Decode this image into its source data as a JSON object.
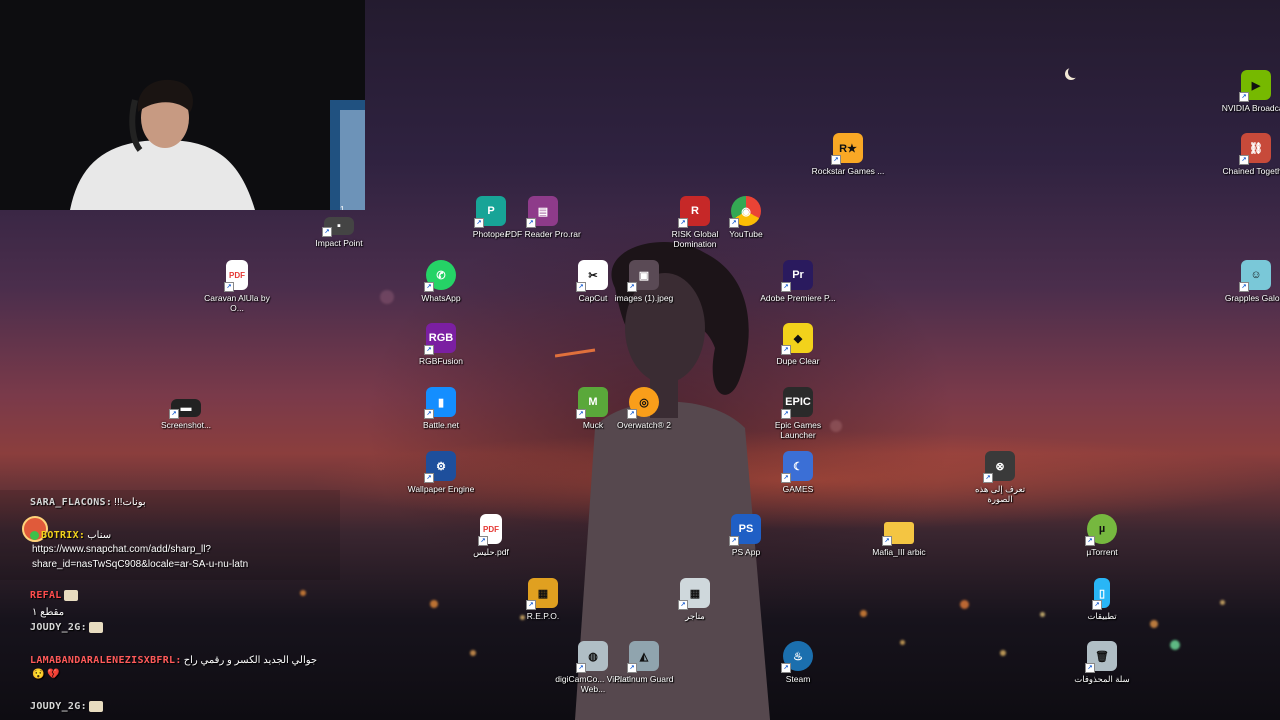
{
  "colors": {
    "sky_top": "#241b2f",
    "sunset": "#8b3e3d",
    "ground": "#0e0c12"
  },
  "webcam": {
    "corner_badge": "1"
  },
  "desktop": {
    "icons": [
      {
        "label": "NVIDIA Broadcast",
        "icon": "nvidia-broadcast-icon",
        "color": "#76b900"
      },
      {
        "label": "Chained Together",
        "icon": "chained-together-icon",
        "color": "#c74a3a"
      },
      {
        "label": "Grapples Galore",
        "icon": "grapples-galore-icon",
        "color": "#7ac8d8"
      },
      {
        "label": "Rockstar Games ...",
        "icon": "rockstar-games-icon",
        "color": "#f9a825"
      },
      {
        "label": "Photopea",
        "icon": "photopea-icon",
        "color": "#18a497"
      },
      {
        "label": "PDF Reader Pro.rar",
        "icon": "winrar-archive-icon",
        "color": "#8e3b8a"
      },
      {
        "label": "RISK Global Domination",
        "icon": "risk-icon",
        "color": "#c62828"
      },
      {
        "label": "YouTube",
        "icon": "chrome-icon",
        "color": "#4285f4"
      },
      {
        "label": "Impact Point",
        "icon": "impact-point-icon",
        "color": "#444"
      },
      {
        "label": "Caravan AlUla by O...",
        "icon": "pdf-file-icon",
        "color": "#e53935"
      },
      {
        "label": "WhatsApp",
        "icon": "whatsapp-icon",
        "color": "#25d366"
      },
      {
        "label": "CapCut",
        "icon": "capcut-icon",
        "color": "#ffffff"
      },
      {
        "label": "images (1).jpeg",
        "icon": "image-file-icon",
        "color": "#5a4a55"
      },
      {
        "label": "Adobe Premiere P...",
        "icon": "premiere-pro-icon",
        "color": "#2a1a5e"
      },
      {
        "label": "RGBFusion",
        "icon": "rgbfusion-icon",
        "color": "#7b1fa2"
      },
      {
        "label": "Dupe Clear",
        "icon": "dupe-clear-icon",
        "color": "#f2d21b"
      },
      {
        "label": "Screenshot...",
        "icon": "screenshot-file-icon",
        "color": "#222"
      },
      {
        "label": "Battle.net",
        "icon": "battlenet-icon",
        "color": "#148eff"
      },
      {
        "label": "Muck",
        "icon": "muck-icon",
        "color": "#5aa83a"
      },
      {
        "label": "Overwatch® 2",
        "icon": "overwatch-icon",
        "color": "#f99e1a"
      },
      {
        "label": "Epic Games Launcher",
        "icon": "epic-games-icon",
        "color": "#2a2a2a"
      },
      {
        "label": "Wallpaper Engine",
        "icon": "wallpaper-engine-icon",
        "color": "#1e4f9c"
      },
      {
        "label": "GAMES",
        "icon": "games-folder-icon",
        "color": "#3b6fd6"
      },
      {
        "label": "تعرف إلى هذه الصورة",
        "icon": "learn-about-picture-icon",
        "color": "#3a3a3a"
      },
      {
        "label": "حليس.pdf",
        "icon": "pdf-file-icon",
        "color": "#e53935"
      },
      {
        "label": "PS App",
        "icon": "playstation-icon",
        "color": "#1f5fc5"
      },
      {
        "label": "Mafia_III arbic",
        "icon": "folder-icon",
        "color": "#f4c542"
      },
      {
        "label": "µTorrent",
        "icon": "utorrent-icon",
        "color": "#76b83f"
      },
      {
        "label": "R.E.P.O.",
        "icon": "repo-game-icon",
        "color": "#e0a020"
      },
      {
        "label": "متاجر",
        "icon": "stores-icon",
        "color": "#cfd8dc"
      },
      {
        "label": "تطبيقات",
        "icon": "apps-icon",
        "color": "#29b6f6"
      },
      {
        "label": "digiCamCo... Virtual Web...",
        "icon": "digicam-icon",
        "color": "#b0bec5"
      },
      {
        "label": "Platinum Guard",
        "icon": "platinum-guard-icon",
        "color": "#90a4ae"
      },
      {
        "label": "Steam",
        "icon": "steam-icon",
        "color": "#1b6fae"
      },
      {
        "label": "سلة المحذوفات",
        "icon": "recycle-bin-icon",
        "color": "#b0bec5"
      }
    ]
  },
  "chat": {
    "messages": [
      {
        "user": "SARA_FLACONS:",
        "text": "!!!بونات",
        "user_color": "#d6d6d6",
        "badge": ""
      },
      {
        "user": "BOTRIX:",
        "text": "سناب",
        "user_color": "#f2d21b",
        "badge": "verified-bot-icon"
      },
      {
        "user": "",
        "text": "https://www.snapchat.com/add/sharp_ll?",
        "user_color": "#ffffff",
        "badge": ""
      },
      {
        "user": "",
        "text": "share_id=nasTwSqC908&locale=ar-SA-u-nu-latn",
        "user_color": "#ffffff",
        "badge": ""
      },
      {
        "user": "REFAL",
        "text": "",
        "user_color": "#ff4d4d",
        "badge": "emote-icon"
      },
      {
        "user": "",
        "text": "مقطع ١",
        "user_color": "#ffffff",
        "badge": ""
      },
      {
        "user": "JOUDY_2G:",
        "text": "",
        "user_color": "#d6d6d6",
        "badge": "emote-icon"
      },
      {
        "user": "LAMABANDARALENEZISXBFRL:",
        "text": "جوالي الجديد الكسر و رقمي راح",
        "user_color": "#ff5a5a",
        "badge": ""
      },
      {
        "user": "",
        "text": "😯 💔",
        "user_color": "#ffffff",
        "badge": ""
      },
      {
        "user": "JOUDY_2G:",
        "text": "",
        "user_color": "#d6d6d6",
        "badge": "emote-icon"
      }
    ]
  }
}
